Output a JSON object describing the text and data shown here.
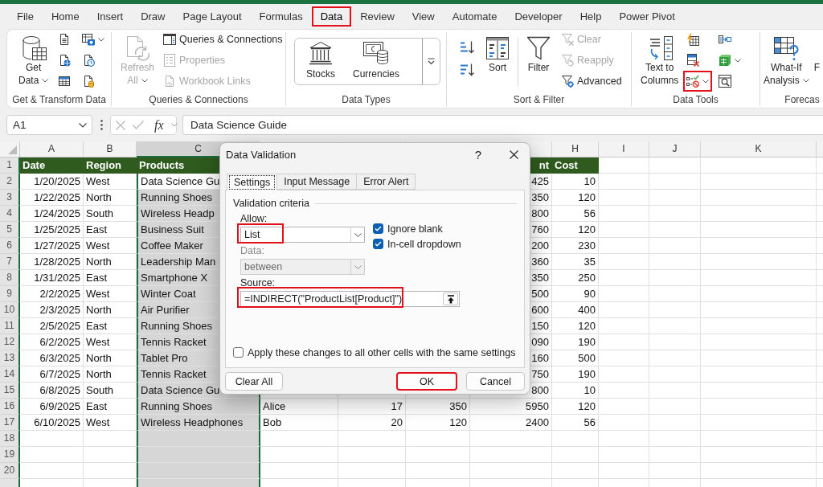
{
  "ribbon_tabs": [
    {
      "label": "File",
      "selected": false,
      "highlighted": false
    },
    {
      "label": "Home",
      "selected": false,
      "highlighted": false
    },
    {
      "label": "Insert",
      "selected": false,
      "highlighted": false
    },
    {
      "label": "Draw",
      "selected": false,
      "highlighted": false
    },
    {
      "label": "Page Layout",
      "selected": false,
      "highlighted": false
    },
    {
      "label": "Formulas",
      "selected": false,
      "highlighted": false
    },
    {
      "label": "Data",
      "selected": true,
      "highlighted": true
    },
    {
      "label": "Review",
      "selected": false,
      "highlighted": false
    },
    {
      "label": "View",
      "selected": false,
      "highlighted": false
    },
    {
      "label": "Automate",
      "selected": false,
      "highlighted": false
    },
    {
      "label": "Developer",
      "selected": false,
      "highlighted": false
    },
    {
      "label": "Help",
      "selected": false,
      "highlighted": false
    },
    {
      "label": "Power Pivot",
      "selected": false,
      "highlighted": false
    }
  ],
  "ribbon": {
    "groups": [
      {
        "label": "Get & Transform Data",
        "items": [
          {
            "kind": "large",
            "label": "Get\nData",
            "dropdown": true,
            "disabled": false,
            "highlighted": false
          },
          {
            "kind": "icon",
            "dropdown": false,
            "disabled": false,
            "highlighted": false
          },
          {
            "kind": "icon",
            "dropdown": false,
            "disabled": false,
            "highlighted": false
          },
          {
            "kind": "icon",
            "dropdown": false,
            "disabled": false,
            "highlighted": false
          },
          {
            "kind": "icon",
            "dropdown": true,
            "disabled": false,
            "highlighted": false
          },
          {
            "kind": "icon",
            "dropdown": false,
            "disabled": false,
            "highlighted": false
          },
          {
            "kind": "icon",
            "dropdown": false,
            "disabled": false,
            "highlighted": false
          }
        ]
      },
      {
        "label": "Queries & Connections",
        "items": [
          {
            "kind": "large",
            "label": "Refresh\nAll",
            "dropdown": true,
            "disabled": true,
            "highlighted": false
          },
          {
            "kind": "small",
            "label": "Queries & Connections",
            "dropdown": false,
            "disabled": false,
            "highlighted": false
          },
          {
            "kind": "small",
            "label": "Properties",
            "dropdown": false,
            "disabled": true,
            "highlighted": false
          },
          {
            "kind": "small",
            "label": "Workbook Links",
            "dropdown": false,
            "disabled": true,
            "highlighted": false
          }
        ]
      },
      {
        "label": "Data Types",
        "items": [
          {
            "kind": "gallery",
            "options": [
              {
                "label": "Stocks"
              },
              {
                "label": "Currencies"
              }
            ]
          }
        ]
      },
      {
        "label": "Sort & Filter",
        "items": [
          {
            "kind": "icon",
            "dropdown": false,
            "disabled": false,
            "highlighted": false
          },
          {
            "kind": "icon",
            "dropdown": false,
            "disabled": false,
            "highlighted": false
          },
          {
            "kind": "large",
            "label": "Sort",
            "dropdown": false,
            "disabled": false,
            "highlighted": false
          },
          {
            "kind": "divider"
          },
          {
            "kind": "large",
            "label": "Filter",
            "dropdown": false,
            "disabled": false,
            "highlighted": false
          },
          {
            "kind": "small",
            "label": "Clear",
            "dropdown": false,
            "disabled": true,
            "highlighted": false
          },
          {
            "kind": "small",
            "label": "Reapply",
            "dropdown": false,
            "disabled": true,
            "highlighted": false
          },
          {
            "kind": "small",
            "label": "Advanced",
            "dropdown": false,
            "disabled": false,
            "highlighted": false
          }
        ]
      },
      {
        "label": "Data Tools",
        "items": [
          {
            "kind": "large",
            "label": "Text to\nColumns",
            "dropdown": false,
            "disabled": false,
            "highlighted": false
          },
          {
            "kind": "icon",
            "dropdown": false,
            "disabled": false,
            "highlighted": false
          },
          {
            "kind": "icon",
            "dropdown": false,
            "disabled": false,
            "highlighted": false
          },
          {
            "kind": "icon",
            "dropdown": true,
            "disabled": false,
            "highlighted": true
          },
          {
            "kind": "icon",
            "dropdown": false,
            "disabled": false,
            "highlighted": false
          },
          {
            "kind": "icon",
            "dropdown": true,
            "disabled": false,
            "highlighted": false
          },
          {
            "kind": "icon",
            "dropdown": false,
            "disabled": false,
            "highlighted": false
          }
        ]
      },
      {
        "label": "Forecas",
        "items": [
          {
            "kind": "large",
            "label": "What-If\nAnalysis",
            "dropdown": true,
            "disabled": false,
            "highlighted": false
          },
          {
            "kind": "large",
            "label": "F",
            "dropdown": false,
            "disabled": false,
            "highlighted": false
          }
        ]
      }
    ]
  },
  "formula_bar": {
    "name_box": "A1",
    "function_label": "fx",
    "formula": "Data Science Guide"
  },
  "sheet": {
    "columns": [
      {
        "label": "A",
        "selected": false
      },
      {
        "label": "B",
        "selected": false
      },
      {
        "label": "C",
        "selected": true
      },
      {
        "selected": false
      },
      {
        "selected": false
      },
      {
        "selected": false
      },
      {
        "selected": false
      },
      {
        "label": "H",
        "selected": false
      },
      {
        "label": "I",
        "selected": false
      },
      {
        "label": "J",
        "selected": false
      },
      {
        "label": "K",
        "selected": false
      }
    ],
    "rows": [
      {
        "number": "1",
        "kind": "header",
        "selected": true,
        "active": false,
        "cells": [
          "Date",
          "Region",
          "Products",
          null,
          null,
          null,
          "nt",
          "Cost"
        ]
      },
      {
        "number": "2",
        "kind": "data",
        "selected": true,
        "active": true,
        "cells": [
          "1/20/2025",
          "West",
          "Data Science Gu",
          null,
          null,
          null,
          "425",
          "10"
        ]
      },
      {
        "number": "3",
        "kind": "data",
        "selected": true,
        "active": false,
        "cells": [
          "1/22/2025",
          "North",
          "Running Shoes",
          null,
          null,
          null,
          "350",
          "120"
        ]
      },
      {
        "number": "4",
        "kind": "data",
        "selected": true,
        "active": false,
        "cells": [
          "1/24/2025",
          "South",
          "Wireless Headp",
          null,
          null,
          null,
          "800",
          "56"
        ]
      },
      {
        "number": "5",
        "kind": "data",
        "selected": true,
        "active": false,
        "cells": [
          "1/25/2025",
          "East",
          "Business Suit",
          null,
          null,
          null,
          "760",
          "120"
        ]
      },
      {
        "number": "6",
        "kind": "data",
        "selected": true,
        "active": false,
        "cells": [
          "1/27/2025",
          "West",
          "Coffee Maker",
          null,
          null,
          null,
          "200",
          "230"
        ]
      },
      {
        "number": "7",
        "kind": "data",
        "selected": true,
        "active": false,
        "cells": [
          "1/28/2025",
          "North",
          "Leadership Man",
          null,
          null,
          null,
          "360",
          "35"
        ]
      },
      {
        "number": "8",
        "kind": "data",
        "selected": true,
        "active": false,
        "cells": [
          "1/31/2025",
          "East",
          "Smartphone X",
          null,
          null,
          null,
          "350",
          "250"
        ]
      },
      {
        "number": "9",
        "kind": "data",
        "selected": true,
        "active": false,
        "cells": [
          "2/2/2025",
          "West",
          "Winter Coat",
          null,
          null,
          null,
          "500",
          "90"
        ]
      },
      {
        "number": "10",
        "kind": "data",
        "selected": true,
        "active": false,
        "cells": [
          "2/3/2025",
          "North",
          "Air Purifier",
          null,
          null,
          null,
          "600",
          "400"
        ]
      },
      {
        "number": "11",
        "kind": "data",
        "selected": true,
        "active": false,
        "cells": [
          "2/5/2025",
          "East",
          "Running Shoes",
          null,
          null,
          null,
          "150",
          "120"
        ]
      },
      {
        "number": "12",
        "kind": "data",
        "selected": true,
        "active": false,
        "cells": [
          "6/2/2025",
          "West",
          "Tennis Racket",
          null,
          null,
          null,
          "090",
          "190"
        ]
      },
      {
        "number": "13",
        "kind": "data",
        "selected": true,
        "active": false,
        "cells": [
          "6/3/2025",
          "North",
          "Tablet Pro",
          null,
          null,
          null,
          "160",
          "500"
        ]
      },
      {
        "number": "14",
        "kind": "data",
        "selected": true,
        "active": false,
        "cells": [
          "6/7/2025",
          "North",
          "Tennis Racket",
          null,
          null,
          null,
          "750",
          "190"
        ]
      },
      {
        "number": "15",
        "kind": "data",
        "selected": true,
        "active": false,
        "cells": [
          "6/8/2025",
          "South",
          "Data Science Gu",
          null,
          null,
          null,
          "800",
          "10"
        ]
      },
      {
        "number": "16",
        "kind": "data",
        "selected": true,
        "active": false,
        "cells": [
          "6/9/2025",
          "East",
          "Running Shoes",
          "Alice",
          "17",
          "350",
          "5950",
          "120"
        ]
      },
      {
        "number": "17",
        "kind": "data",
        "selected": true,
        "active": false,
        "cells": [
          "6/10/2025",
          "West",
          "Wireless Headphones",
          "Bob",
          "20",
          "120",
          "2400",
          "56"
        ]
      },
      {
        "number": "18",
        "kind": "data",
        "selected": true,
        "active": false
      },
      {
        "number": "19",
        "kind": "data",
        "selected": true,
        "active": false
      },
      {
        "number": "20",
        "kind": "data",
        "selected": true,
        "active": false
      }
    ]
  },
  "dialog": {
    "title": "Data Validation",
    "help_label": "?",
    "tabs": [
      {
        "label": "Settings",
        "selected": true
      },
      {
        "label": "Input Message",
        "selected": false
      },
      {
        "label": "Error Alert",
        "selected": false
      }
    ],
    "section_title": "Validation criteria",
    "fields": [
      {
        "kind": "select",
        "label": "Allow:",
        "value": "List",
        "disabled": false,
        "highlighted": true
      },
      {
        "kind": "select",
        "label": "Data:",
        "value": "between",
        "disabled": true,
        "highlighted": false
      },
      {
        "kind": "range",
        "label": "Source:",
        "value": "=INDIRECT(\"ProductList[Product]\")",
        "disabled": false,
        "highlighted": true
      }
    ],
    "options": [
      {
        "label": "Ignore blank",
        "checked": true
      },
      {
        "label": "In-cell dropdown",
        "checked": true
      }
    ],
    "apply_all": {
      "label": "Apply these changes to all other cells with the same settings",
      "checked": false
    },
    "buttons": [
      {
        "label": "Clear All",
        "highlighted": false
      },
      {
        "label": "OK",
        "highlighted": true
      },
      {
        "label": "Cancel",
        "highlighted": false
      }
    ]
  }
}
